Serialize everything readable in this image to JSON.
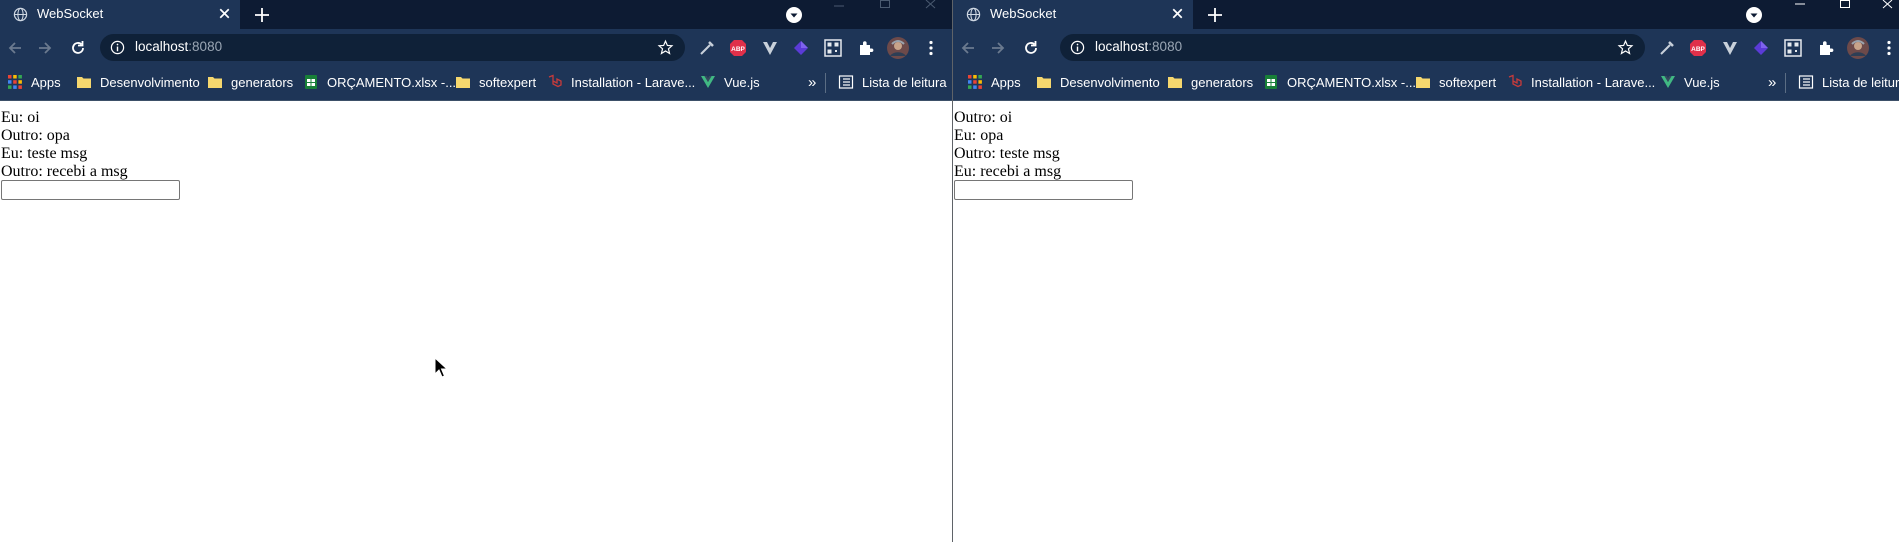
{
  "windows": [
    {
      "tab": {
        "title": "WebSocket"
      },
      "address": {
        "host": "localhost",
        "port": ":8080"
      },
      "bookmarks": {
        "apps": "Apps",
        "desenvolvimento": "Desenvolvimento",
        "generators": "generators",
        "orcamento": "ORÇAMENTO.xlsx -...",
        "softexpert": "softexpert",
        "laravel": "Installation - Larave...",
        "vue": "Vue.js",
        "more": "»",
        "reading_list": "Lista de leitura"
      },
      "messages": [
        "Eu: oi",
        "Outro: opa",
        "Eu: teste msg",
        "Outro: recebi a msg"
      ],
      "input": {
        "value": ""
      }
    },
    {
      "tab": {
        "title": "WebSocket"
      },
      "address": {
        "host": "localhost",
        "port": ":8080"
      },
      "bookmarks": {
        "apps": "Apps",
        "desenvolvimento": "Desenvolvimento",
        "generators": "generators",
        "orcamento": "ORÇAMENTO.xlsx -...",
        "softexpert": "softexpert",
        "laravel": "Installation - Larave...",
        "vue": "Vue.js",
        "more": "»",
        "reading_list": "Lista de leitura"
      },
      "messages": [
        "Outro: oi",
        "Eu: opa",
        "Outro: teste msg",
        "Eu: recebi a msg"
      ],
      "input": {
        "value": ""
      }
    }
  ],
  "colors": {
    "titlebar": "#0d1b33",
    "toolbar": "#1e3557",
    "omnibox": "#0f2138",
    "abp": "#e0304a",
    "sheets_green": "#188038",
    "folder": "#f5d76e",
    "vue_green": "#41b883",
    "laravel_red": "#c73b3b"
  },
  "icons": {
    "tab_favicon": "globe-icon",
    "tab_close": "close-icon",
    "new_tab": "plus-icon",
    "tab_search": "chevron-down-icon",
    "back": "back-arrow-icon",
    "forward": "forward-arrow-icon",
    "reload": "reload-icon",
    "site_info": "info-icon",
    "bookmark_star": "star-icon",
    "extensions": [
      "eyedropper-icon",
      "abp-icon",
      "vuetify-icon",
      "gem-icon",
      "qr-code-icon",
      "puzzle-icon",
      "avatar",
      "kebab-menu-icon"
    ]
  }
}
